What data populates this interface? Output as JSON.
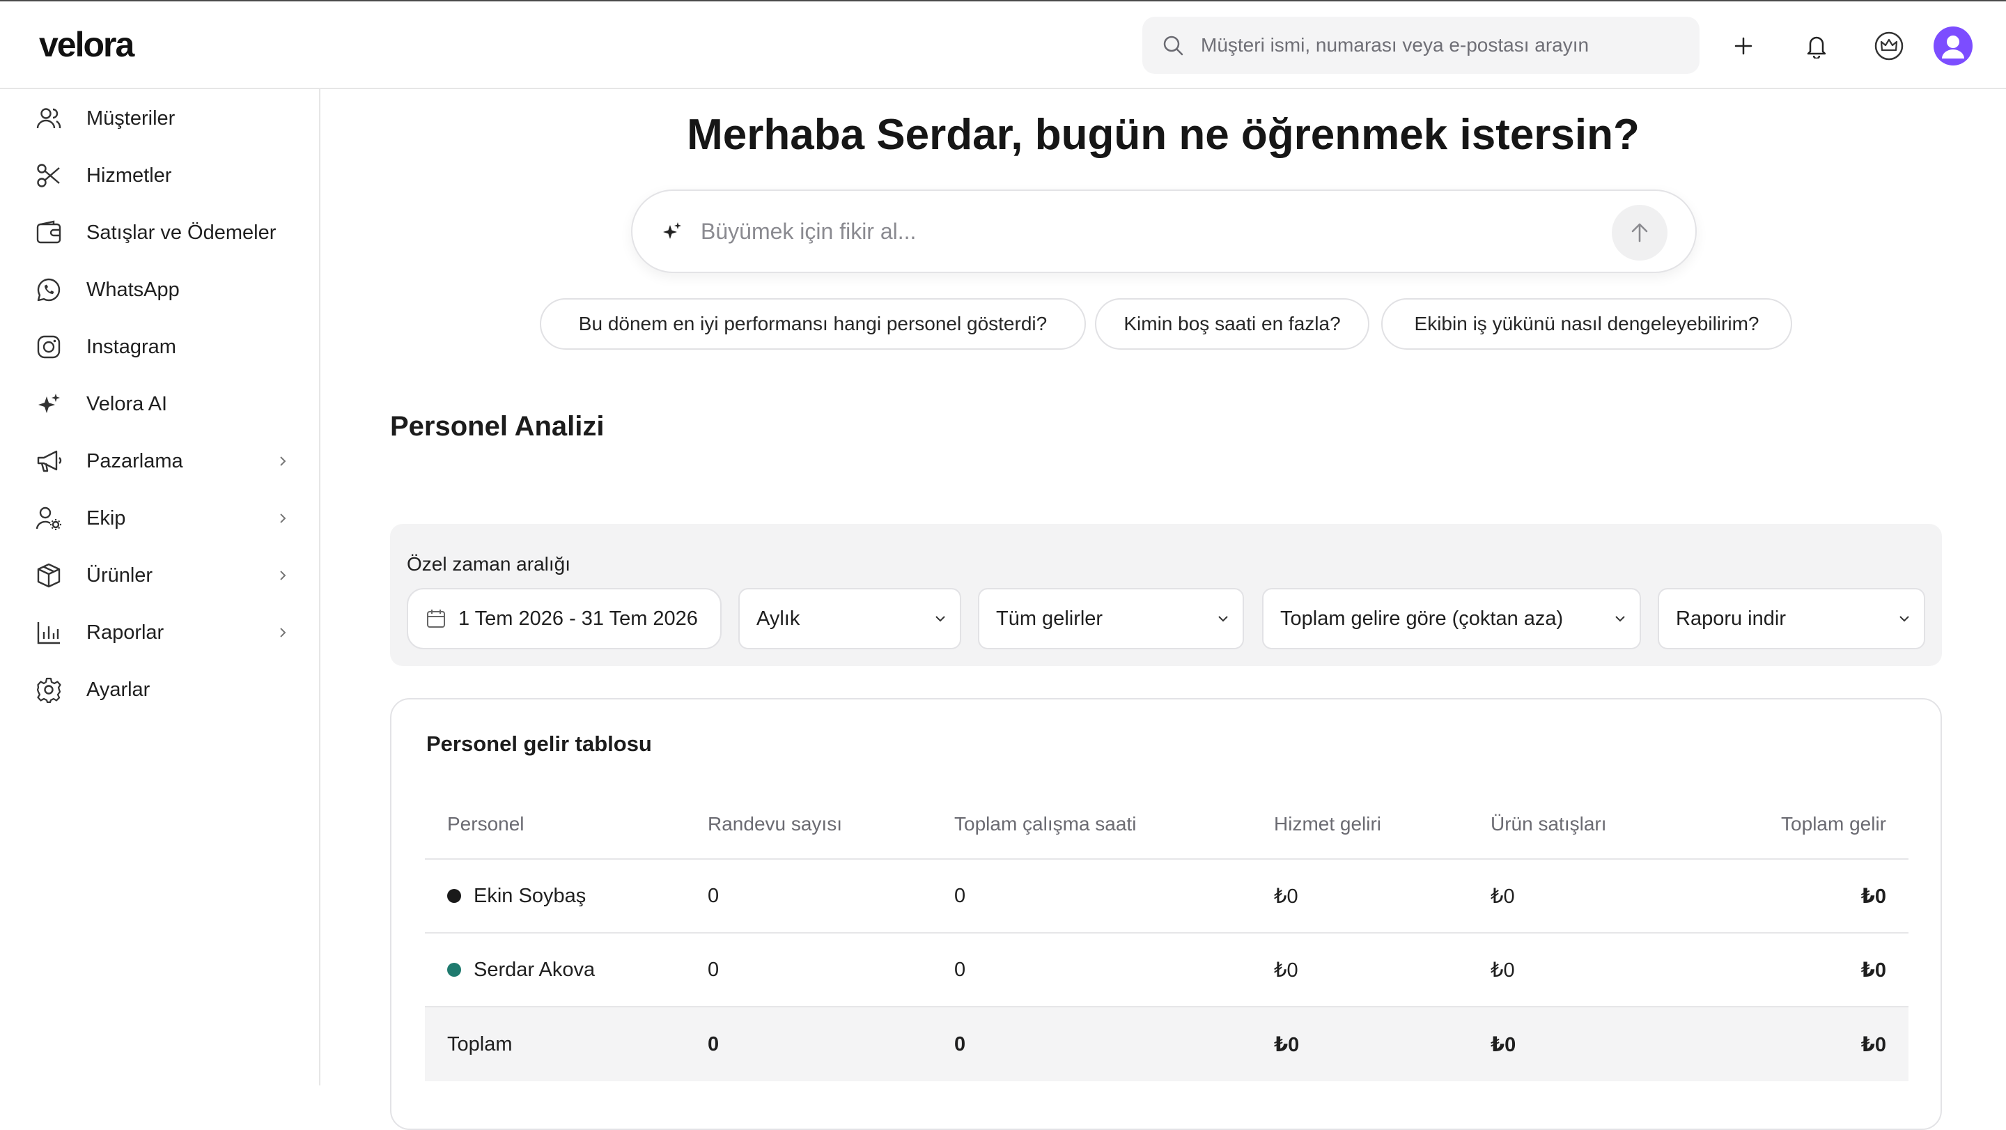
{
  "brand": {
    "logo_text": "velora"
  },
  "header": {
    "search_placeholder": "Müşteri ismi, numarası veya e-postası arayın",
    "icons": [
      "search-icon",
      "plus-icon",
      "bell-icon",
      "crown-icon",
      "user-avatar-icon"
    ]
  },
  "sidebar": {
    "items": [
      {
        "label": "Müşteriler",
        "icon": "users-icon",
        "has_submenu": false
      },
      {
        "label": "Hizmetler",
        "icon": "scissors-icon",
        "has_submenu": false
      },
      {
        "label": "Satışlar ve Ödemeler",
        "icon": "wallet-icon",
        "has_submenu": false
      },
      {
        "label": "WhatsApp",
        "icon": "whatsapp-icon",
        "has_submenu": false
      },
      {
        "label": "Instagram",
        "icon": "instagram-icon",
        "has_submenu": false
      },
      {
        "label": "Velora AI",
        "icon": "sparkle-icon",
        "has_submenu": false
      },
      {
        "label": "Pazarlama",
        "icon": "megaphone-icon",
        "has_submenu": true
      },
      {
        "label": "Ekip",
        "icon": "team-settings-icon",
        "has_submenu": true
      },
      {
        "label": "Ürünler",
        "icon": "box-icon",
        "has_submenu": true
      },
      {
        "label": "Raporlar",
        "icon": "bar-chart-icon",
        "has_submenu": true
      },
      {
        "label": "Ayarlar",
        "icon": "gear-icon",
        "has_submenu": false
      }
    ]
  },
  "main": {
    "greeting": "Merhaba Serdar, bugün ne öğrenmek istersin?",
    "ai_prompt": {
      "placeholder": "Büyümek için fikir al..."
    },
    "suggestions": [
      "Bu dönem en iyi performansı hangi personel gösterdi?",
      "Kimin boş saati en fazla?",
      "Ekibin iş yükünü nasıl dengeleyebilirim?"
    ],
    "section_title": "Personel Analizi",
    "filters": {
      "label": "Özel zaman aralığı",
      "date_range": "1 Tem 2026 - 31 Tem 2026",
      "period": "Aylık",
      "income_type": "Tüm gelirler",
      "sort": "Toplam gelire göre (çoktan aza)",
      "download": "Raporu indir"
    },
    "table": {
      "title": "Personel gelir tablosu",
      "columns": [
        "Personel",
        "Randevu sayısı",
        "Toplam çalışma saati",
        "Hizmet geliri",
        "Ürün satışları",
        "Toplam gelir"
      ],
      "rows": [
        {
          "name": "Ekin Soybaş",
          "color": "#1a1a1a",
          "appointments": "0",
          "hours": "0",
          "service_income": "₺0",
          "product_sales": "₺0",
          "total": "₺0"
        },
        {
          "name": "Serdar Akova",
          "color": "#1f7a6e",
          "appointments": "0",
          "hours": "0",
          "service_income": "₺0",
          "product_sales": "₺0",
          "total": "₺0"
        }
      ],
      "total_row": {
        "label": "Toplam",
        "appointments": "0",
        "hours": "0",
        "service_income": "₺0",
        "product_sales": "₺0",
        "total": "₺0"
      }
    }
  },
  "colors": {
    "accent_avatar": "#7c4dff",
    "staff_teal": "#1f7a6e",
    "panel_bg": "#f3f3f4"
  }
}
